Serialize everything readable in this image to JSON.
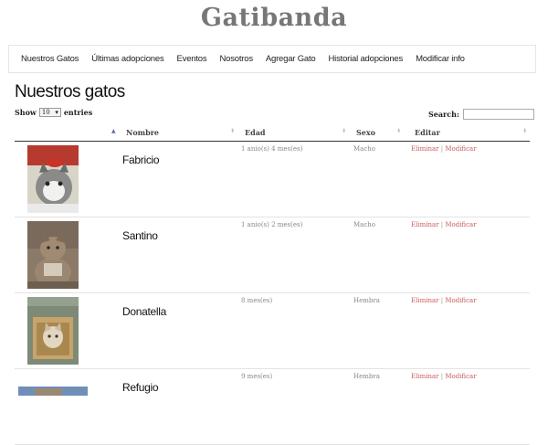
{
  "site": {
    "title": "Gatibanda"
  },
  "nav": [
    "Nuestros Gatos",
    "Últimas adopciones",
    "Eventos",
    "Nosotros",
    "Agregar Gato",
    "Historial adopciones",
    "Modificar info"
  ],
  "page": {
    "heading": "Nuestros gatos"
  },
  "table_controls": {
    "show_label": "Show",
    "entries_value": "10",
    "entries_label": "entries",
    "search_label": "Search:",
    "search_value": ""
  },
  "columns": [
    "Nombre",
    "Edad",
    "Sexo",
    "Editar"
  ],
  "rows": [
    {
      "name": "Fabricio",
      "age": "1 anio(s) 4 mes(es)",
      "sex": "Macho",
      "delete": "Eliminar",
      "sep": "|",
      "modify": "Modificar"
    },
    {
      "name": "Santino",
      "age": "1 anio(s) 2 mes(es)",
      "sex": "Macho",
      "delete": "Eliminar",
      "sep": "|",
      "modify": "Modificar"
    },
    {
      "name": "Donatella",
      "age": "8 mes(es)",
      "sex": "Hembra",
      "delete": "Eliminar",
      "sep": "|",
      "modify": "Modificar"
    },
    {
      "name": "Refugio",
      "age": "9 mes(es)",
      "sex": "Hembra",
      "delete": "Eliminar",
      "sep": "|",
      "modify": "Modificar"
    }
  ],
  "colors": {
    "link": "#c95c5c",
    "title": "#777777",
    "sort_active": "#5b6bb0"
  }
}
